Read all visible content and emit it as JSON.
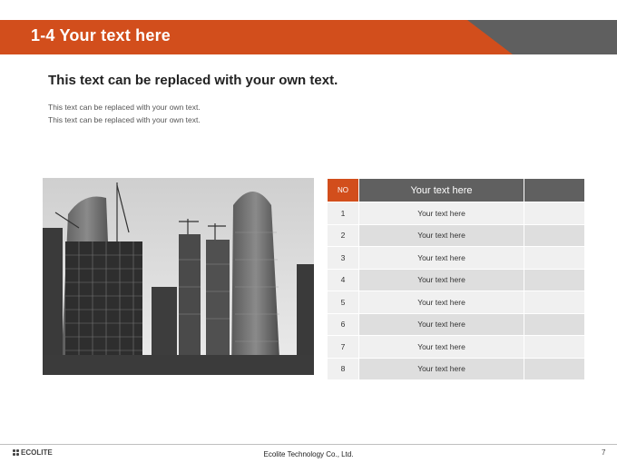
{
  "header": {
    "title": "1-4 Your text here"
  },
  "content": {
    "heading": "This text can be replaced with your own text.",
    "body_lines": [
      "This text can be replaced with your own text.",
      "This text can be replaced with your own text."
    ]
  },
  "table": {
    "col_no": "NO",
    "col_text": "Your text here",
    "rows": [
      {
        "no": "1",
        "text": "Your text here"
      },
      {
        "no": "2",
        "text": "Your text here"
      },
      {
        "no": "3",
        "text": "Your text here"
      },
      {
        "no": "4",
        "text": "Your text here"
      },
      {
        "no": "5",
        "text": "Your text here"
      },
      {
        "no": "6",
        "text": "Your text here"
      },
      {
        "no": "7",
        "text": "Your text here"
      },
      {
        "no": "8",
        "text": "Your text here"
      }
    ]
  },
  "footer": {
    "logo": "ECOLITE",
    "company": "Ecolite Technology Co., Ltd.",
    "page": "7"
  },
  "colors": {
    "accent": "#d24e1c",
    "header_gray": "#5f5f5f"
  }
}
